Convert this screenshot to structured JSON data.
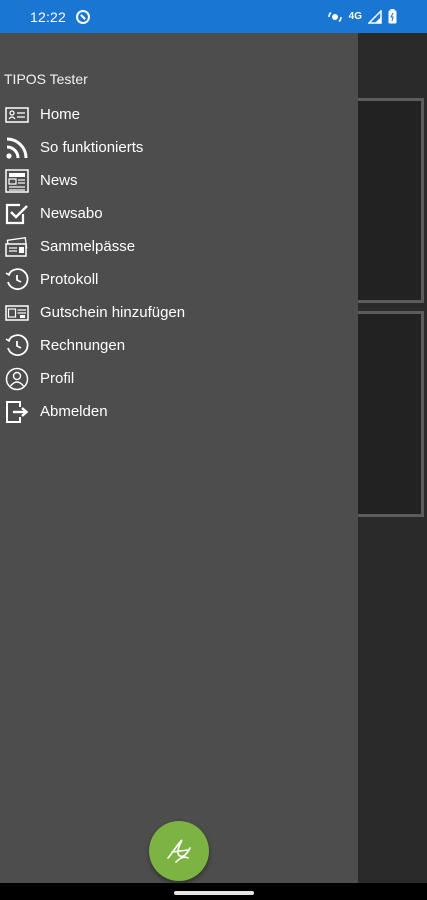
{
  "status_bar": {
    "time": "12:22",
    "network_label": "4G",
    "icons": [
      "dnd-icon",
      "sync-icon",
      "signal-icon",
      "battery-icon"
    ],
    "color": "#1976d2"
  },
  "drawer": {
    "user_name": "TIPOS Tester",
    "background": "#4c4d4c",
    "items": [
      {
        "label": "Home",
        "icon": "id-card-icon"
      },
      {
        "label": "So funktionierts",
        "icon": "rss-icon"
      },
      {
        "label": "News",
        "icon": "newspaper-icon"
      },
      {
        "label": "Newsabo",
        "icon": "checkbox-icon"
      },
      {
        "label": "Sammelpässe",
        "icon": "tickets-icon"
      },
      {
        "label": "Protokoll",
        "icon": "history-icon"
      },
      {
        "label": "Gutschein hinzufügen",
        "icon": "voucher-icon"
      },
      {
        "label": "Rechnungen",
        "icon": "history-icon"
      },
      {
        "label": "Profil",
        "icon": "profile-icon"
      },
      {
        "label": "Abmelden",
        "icon": "logout-icon"
      }
    ]
  },
  "fab": {
    "icon": "signature-logo-icon",
    "color": "#7cb342"
  }
}
